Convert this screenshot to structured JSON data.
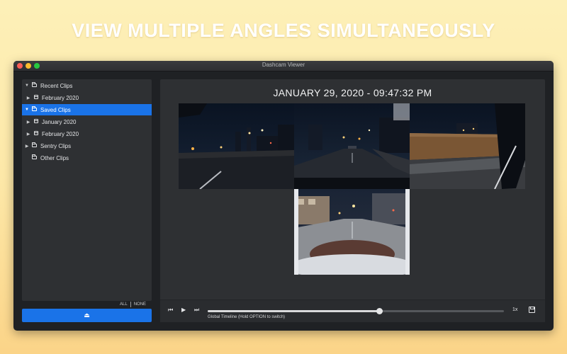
{
  "headline": "VIEW MULTIPLE ANGLES SIMULTANEOUSLY",
  "window": {
    "title": "Dashcam Viewer"
  },
  "sidebar": {
    "items": [
      {
        "label": "Recent Clips",
        "icon": "folder-icon",
        "expanded": true,
        "selected": false,
        "level": 0,
        "has_children": true
      },
      {
        "label": "February 2020",
        "icon": "calendar-icon",
        "expanded": false,
        "selected": false,
        "level": 1,
        "has_children": true
      },
      {
        "label": "Saved Clips",
        "icon": "folder-icon",
        "expanded": true,
        "selected": true,
        "level": 0,
        "has_children": true
      },
      {
        "label": "January 2020",
        "icon": "calendar-icon",
        "expanded": false,
        "selected": false,
        "level": 1,
        "has_children": true
      },
      {
        "label": "February 2020",
        "icon": "calendar-icon",
        "expanded": false,
        "selected": false,
        "level": 1,
        "has_children": true
      },
      {
        "label": "Sentry Clips",
        "icon": "folder-icon",
        "expanded": false,
        "selected": false,
        "level": 0,
        "has_children": true
      },
      {
        "label": "Other Clips",
        "icon": "folder-icon",
        "expanded": false,
        "selected": false,
        "level": 0,
        "has_children": false
      }
    ],
    "all_label": "ALL",
    "none_label": "NONE",
    "eject_icon": "eject-icon"
  },
  "viewer": {
    "timestamp": "JANUARY 29, 2020 - 09:47:32 PM"
  },
  "controls": {
    "speed": "1x",
    "timeline_label": "Global Timeline (Hold OPTION to switch)",
    "progress": 0.58
  },
  "colors": {
    "accent": "#1a73e8",
    "window_bg": "#1f2124",
    "panel_bg": "#2e3033"
  }
}
